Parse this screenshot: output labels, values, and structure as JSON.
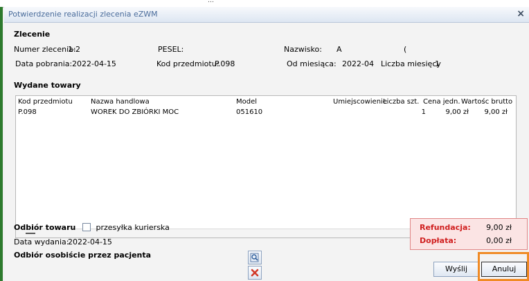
{
  "window": {
    "title": "Potwierdzenie realizacji zlecenia eZWM",
    "close_icon": "close-icon"
  },
  "order": {
    "section_title": "Zlecenie",
    "number_label": "Numer zlecenia:",
    "number_value": "1-2",
    "pesel_label": "PESEL:",
    "pesel_value": "",
    "surname_label": "Nazwisko:",
    "surname_value": "A",
    "surname_extra": "(",
    "collect_date_label": "Data pobrania:",
    "collect_date_value": "2022-04-15",
    "item_code_label": "Kod przedmiotu:",
    "item_code_value": "P.098",
    "from_month_label": "Od miesiąca:",
    "from_month_value": "2022-04",
    "months_label": "Liczba miesięcy",
    "months_value": "1"
  },
  "items": {
    "section_title": "Wydane towary",
    "columns": [
      "Kod przedmiotu",
      "Nazwa handlowa",
      "Model",
      "Umiejscowienie",
      "Liczba szt.",
      "Cena jedn.",
      "Wartośc brutto"
    ],
    "rows": [
      {
        "code": "P.098",
        "name": "WOREK DO ZBIÓRKI MOC",
        "model": "051610",
        "location": "",
        "qty": "1",
        "unit_price": "9,00 zł",
        "gross": "9,00 zł"
      }
    ]
  },
  "receipt": {
    "section_title": "Odbiór towaru",
    "courier_label": "przesyłka kurierska",
    "courier_checked": false,
    "issue_date_label": "Data wydania:",
    "issue_date_value": "2022-04-15",
    "personal_pickup": "Odbiór osobiście przez pacjenta"
  },
  "totals": {
    "refund_label": "Refundacja:",
    "refund_value": "9,00 zł",
    "copay_label": "Dopłata:",
    "copay_value": "0,00 zł"
  },
  "buttons": {
    "send": "Wyślij",
    "cancel": "Anuluj"
  },
  "icons": {
    "preview": "magnifier-icon",
    "delete": "red-x-icon"
  },
  "colors": {
    "accent": "#4a6c9b",
    "alert": "#d02020",
    "highlight": "#f08a24"
  }
}
